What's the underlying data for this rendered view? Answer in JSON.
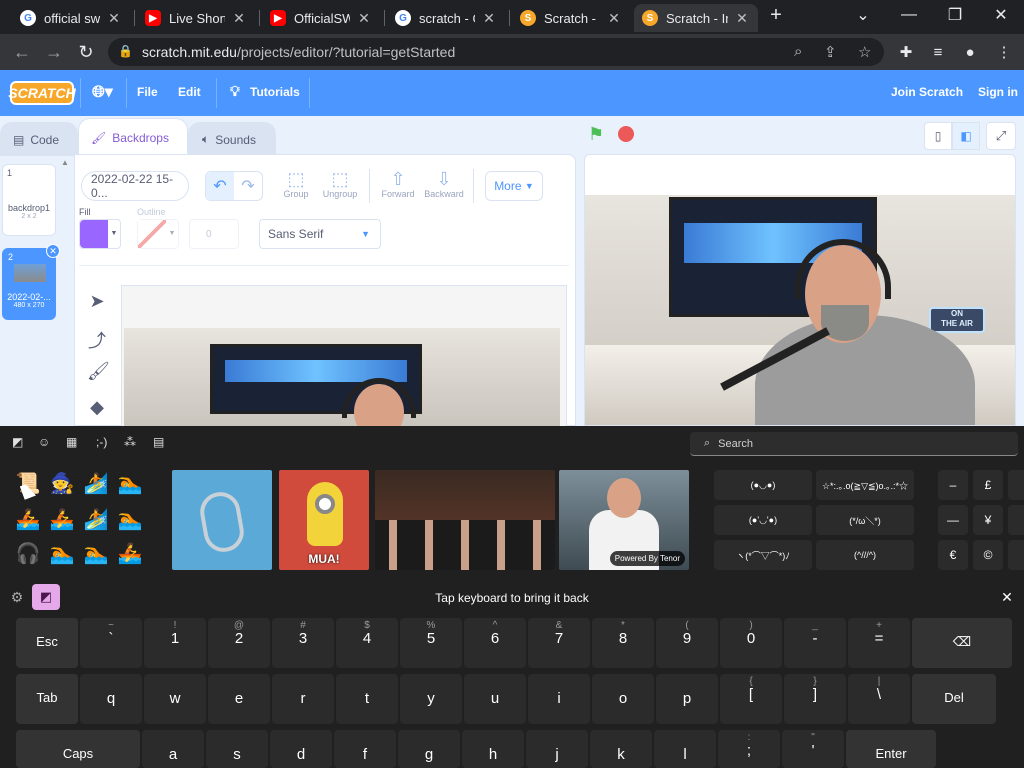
{
  "browser": {
    "tabs": [
      {
        "title": "official swi",
        "favicon": "google-g"
      },
      {
        "title": "Live Shortw",
        "favicon": "youtube"
      },
      {
        "title": "OfficialSWl",
        "favicon": "youtube"
      },
      {
        "title": "scratch - Go",
        "favicon": "google-g"
      },
      {
        "title": "Scratch - Im",
        "favicon": "scratch"
      },
      {
        "title": "Scratch - Im",
        "favicon": "scratch"
      }
    ],
    "new_tab": "+",
    "url_domain": "scratch.mit.edu",
    "url_path": "/projects/editor/?tutorial=getStarted"
  },
  "scratch": {
    "logo": "SCRATCH",
    "menu": {
      "file": "File",
      "edit": "Edit",
      "tutorials": "Tutorials",
      "join": "Join Scratch",
      "signin": "Sign in"
    },
    "tabs": {
      "code": "Code",
      "backdrops": "Backdrops",
      "sounds": "Sounds"
    },
    "backdrops": [
      {
        "num": "1",
        "name": "backdrop1",
        "size": "2 x 2"
      },
      {
        "num": "2",
        "name": "2022-02-...",
        "size": "480 x 270"
      }
    ],
    "editor": {
      "costume_name": "2022-02-22 15-0...",
      "group": "Group",
      "ungroup": "Ungroup",
      "forward": "Forward",
      "backward": "Backward",
      "more": "More",
      "fill_label": "Fill",
      "outline_label": "Outline",
      "outline_width": "0",
      "font": "Sans Serif",
      "fill_color": "#9966ff"
    }
  },
  "emoji_panel": {
    "search_placeholder": "Search",
    "gif_caption_mua": "MUA!",
    "tenor": "Powered By Tenor",
    "kaomoji": [
      "(●◡●)",
      "☆*:.｡.o(≧▽≦)o.｡.:*☆",
      "(●'◡'●)",
      "(*/ω＼*)",
      "ヽ(*⌒▽⌒*)ﾉ",
      "(^///^)"
    ],
    "symbols": [
      "–",
      "£",
      "—",
      "¥",
      "€",
      "©"
    ],
    "message": "Tap keyboard to bring it back"
  },
  "keyboard": {
    "row1": [
      {
        "s": "",
        "m": "Esc"
      },
      {
        "s": "~",
        "m": "`"
      },
      {
        "s": "!",
        "m": "1"
      },
      {
        "s": "@",
        "m": "2"
      },
      {
        "s": "#",
        "m": "3"
      },
      {
        "s": "$",
        "m": "4"
      },
      {
        "s": "%",
        "m": "5"
      },
      {
        "s": "^",
        "m": "6"
      },
      {
        "s": "&",
        "m": "7"
      },
      {
        "s": "*",
        "m": "8"
      },
      {
        "s": "(",
        "m": "9"
      },
      {
        "s": ")",
        "m": "0"
      },
      {
        "s": "_",
        "m": "-"
      },
      {
        "s": "+",
        "m": "="
      },
      {
        "s": "",
        "m": "⌫"
      }
    ],
    "row2": [
      {
        "s": "",
        "m": "Tab"
      },
      {
        "s": "",
        "m": "q"
      },
      {
        "s": "",
        "m": "w"
      },
      {
        "s": "",
        "m": "e"
      },
      {
        "s": "",
        "m": "r"
      },
      {
        "s": "",
        "m": "t"
      },
      {
        "s": "",
        "m": "y"
      },
      {
        "s": "",
        "m": "u"
      },
      {
        "s": "",
        "m": "i"
      },
      {
        "s": "",
        "m": "o"
      },
      {
        "s": "",
        "m": "p"
      },
      {
        "s": "{",
        "m": "["
      },
      {
        "s": "}",
        "m": "]"
      },
      {
        "s": "|",
        "m": "\\"
      },
      {
        "s": "",
        "m": "Del"
      }
    ],
    "row3": [
      {
        "s": "",
        "m": "Caps"
      },
      {
        "s": "",
        "m": "a"
      },
      {
        "s": "",
        "m": "s"
      },
      {
        "s": "",
        "m": "d"
      },
      {
        "s": "",
        "m": "f"
      },
      {
        "s": "",
        "m": "g"
      },
      {
        "s": "",
        "m": "h"
      },
      {
        "s": "",
        "m": "j"
      },
      {
        "s": "",
        "m": "k"
      },
      {
        "s": "",
        "m": "l"
      },
      {
        "s": ":",
        "m": ";"
      },
      {
        "s": "\"",
        "m": "'"
      },
      {
        "s": "",
        "m": "Enter"
      }
    ]
  }
}
